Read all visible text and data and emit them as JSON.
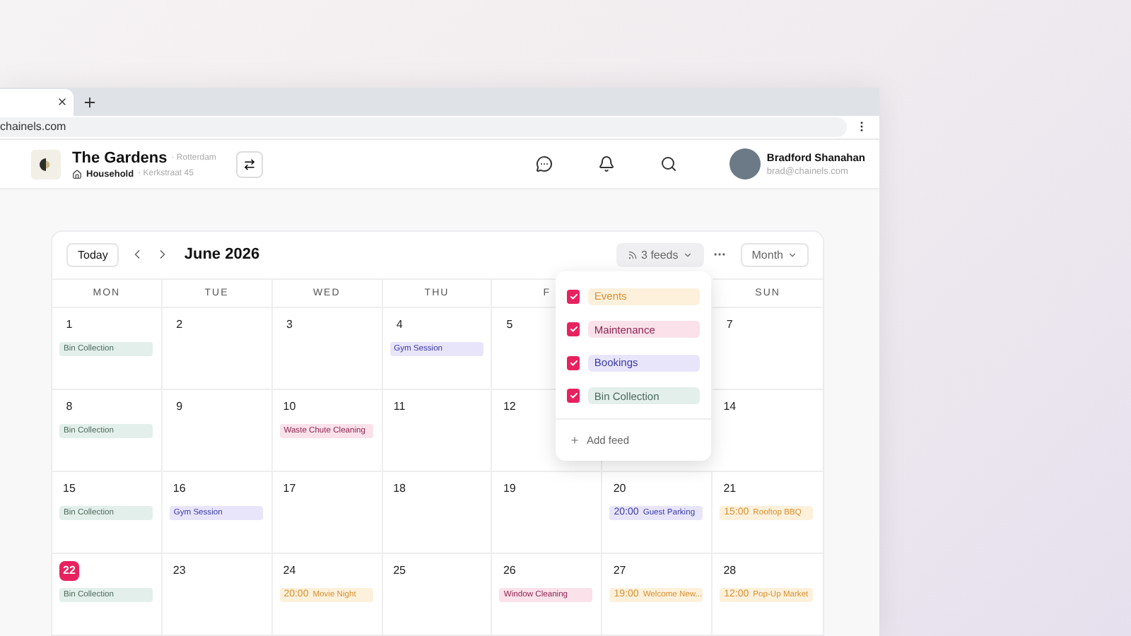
{
  "browser": {
    "address": "chainels.com"
  },
  "header": {
    "community": "The Gardens",
    "city": "· Rotterdam",
    "unit": "Household",
    "address": "· Kerkstraat 45",
    "user": {
      "name": "Bradford Shanahan",
      "email": "brad@chainels.com"
    }
  },
  "toolbar": {
    "today": "Today",
    "month": "June 2026",
    "feeds": "3 feeds",
    "view": "Month"
  },
  "weekdays": [
    {
      "label": "MON"
    },
    {
      "label": "TUE"
    },
    {
      "label": "WED"
    },
    {
      "label": "THU"
    },
    {
      "label": "F"
    },
    {
      "label": "SUN"
    }
  ],
  "weeks": [
    {
      "days": [
        {
          "day": "1",
          "today": false,
          "events": [
            {
              "kind": "bin",
              "label": "Bin Collection"
            }
          ]
        },
        {
          "day": "2",
          "today": false
        },
        {
          "day": "3",
          "today": false
        },
        {
          "day": "4",
          "today": false,
          "events": [
            {
              "kind": "booking",
              "label": "Gym Session"
            }
          ]
        },
        {
          "day": "5",
          "today": false
        },
        {
          "day": "7",
          "today": false
        }
      ]
    },
    {
      "days": [
        {
          "day": "8",
          "today": false,
          "events": [
            {
              "kind": "bin",
              "label": "Bin Collection"
            }
          ]
        },
        {
          "day": "9",
          "today": false
        },
        {
          "day": "10",
          "today": false,
          "events": [
            {
              "kind": "maintenance",
              "label": "Waste Chute Cleaning"
            }
          ]
        },
        {
          "day": "11",
          "today": false
        },
        {
          "day": "12",
          "today": false
        },
        {
          "day": "14",
          "today": false
        }
      ]
    },
    {
      "days": [
        {
          "day": "15",
          "today": false,
          "events": [
            {
              "kind": "bin",
              "label": "Bin Collection"
            }
          ]
        },
        {
          "day": "16",
          "today": false,
          "events": [
            {
              "kind": "booking",
              "label": "Gym Session"
            }
          ]
        },
        {
          "day": "17",
          "today": false
        },
        {
          "day": "18",
          "today": false
        },
        {
          "day": "19",
          "today": false
        },
        {
          "day": "20",
          "today": false,
          "events": [
            {
              "kind": "booking",
              "time": "20:00",
              "label": "Guest Parking"
            }
          ]
        },
        {
          "day": "21",
          "today": false,
          "events": [
            {
              "kind": "event",
              "time": "15:00",
              "label": "Rooftop BBQ"
            }
          ]
        }
      ]
    },
    {
      "days": [
        {
          "day": "22",
          "today": true,
          "events": [
            {
              "kind": "bin",
              "label": "Bin Collection"
            }
          ]
        },
        {
          "day": "23",
          "today": false
        },
        {
          "day": "24",
          "today": false,
          "events": [
            {
              "kind": "event",
              "time": "20:00",
              "label": "Movie Night"
            }
          ]
        },
        {
          "day": "25",
          "today": false
        },
        {
          "day": "26",
          "today": false,
          "events": [
            {
              "kind": "maintenance",
              "label": "Window Cleaning"
            }
          ]
        },
        {
          "day": "27",
          "today": false,
          "events": [
            {
              "kind": "event",
              "time": "19:00",
              "label": "Welcome New..."
            }
          ]
        },
        {
          "day": "28",
          "today": false,
          "events": [
            {
              "kind": "event",
              "time": "12:00",
              "label": "Pop-Up Market"
            }
          ]
        }
      ]
    }
  ],
  "feed_menu": {
    "feeds": [
      {
        "kind": "event",
        "label": "Events",
        "checked": true
      },
      {
        "kind": "maintenance",
        "label": "Maintenance",
        "checked": true
      },
      {
        "kind": "booking",
        "label": "Bookings",
        "checked": true
      },
      {
        "kind": "bin",
        "label": "Bin Collection",
        "checked": true
      }
    ],
    "add": "Add feed"
  }
}
